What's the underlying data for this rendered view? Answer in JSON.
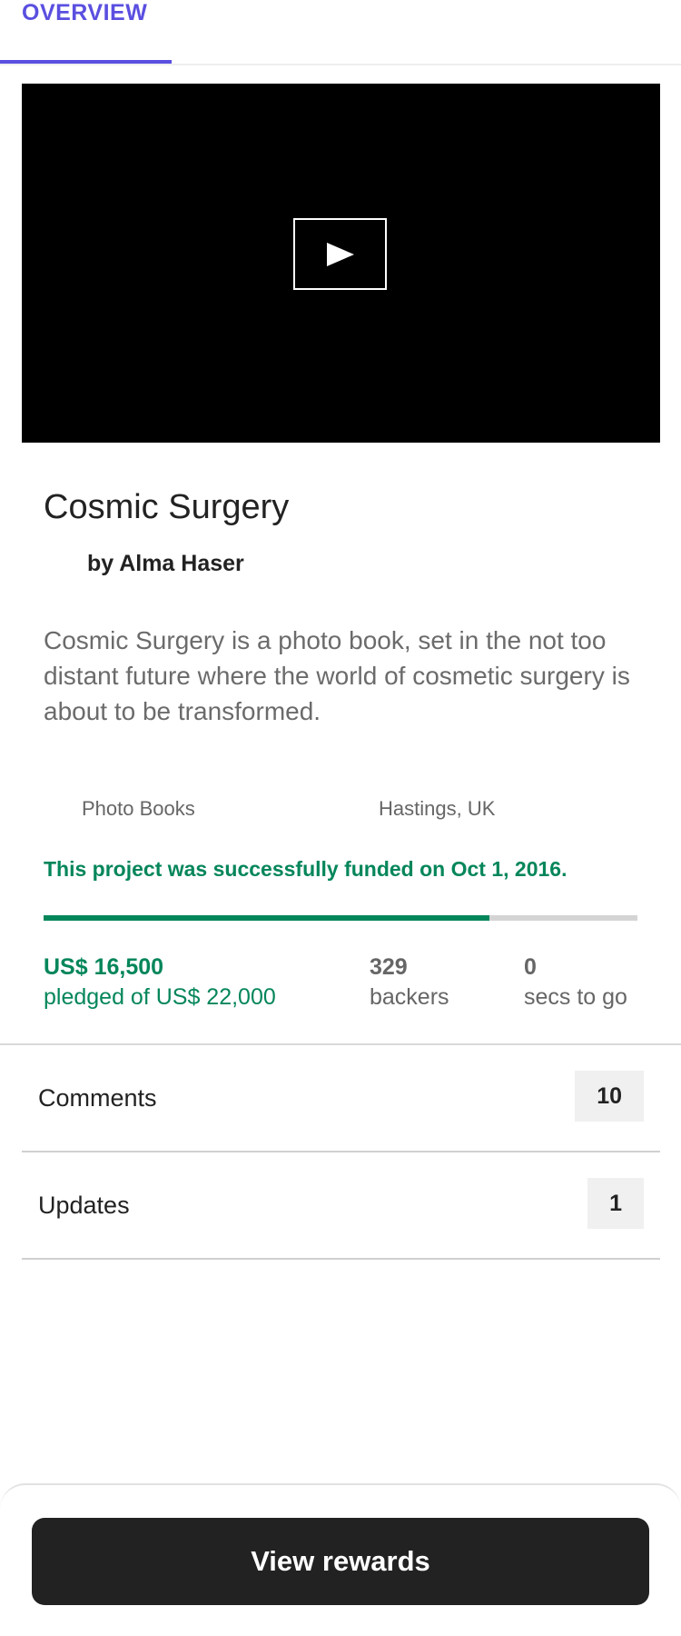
{
  "tabs": {
    "overview_label": "OVERVIEW"
  },
  "video": {
    "play_icon": "play-icon"
  },
  "project": {
    "title": "Cosmic Surgery",
    "creator": "by Alma Haser",
    "blurb": "Cosmic Surgery is a photo book, set in the not too distant future where the world of cosmetic surgery is about to be transformed.",
    "category": "Photo Books",
    "location": "Hastings, UK",
    "status": "This project was successfully funded on Oct 1, 2016.",
    "funding_progress": 0.75
  },
  "stats": {
    "pledged_amount": "US$ 16,500",
    "pledged_of": "pledged of US$ 22,000",
    "backers_count": "329",
    "backers_label": "backers",
    "time_count": "0",
    "time_label": "secs to go"
  },
  "rows": {
    "comments_label": "Comments",
    "comments_count": "10",
    "updates_label": "Updates",
    "updates_count": "1"
  },
  "footer": {
    "rewards_label": "View rewards"
  },
  "colors": {
    "accent": "#5a4fe0",
    "success": "#05865a",
    "button": "#222222"
  }
}
